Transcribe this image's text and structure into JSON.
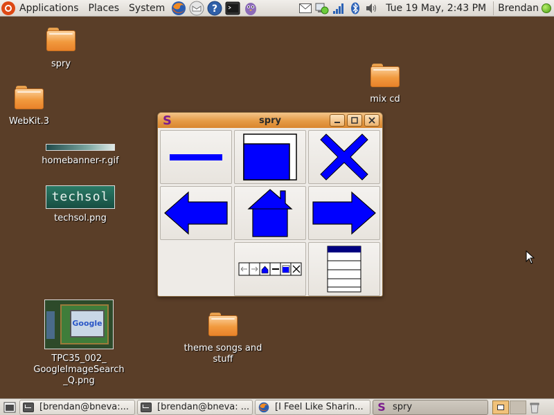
{
  "top_panel": {
    "menus": [
      "Applications",
      "Places",
      "System"
    ],
    "launchers": [
      "firefox-icon",
      "mail-icon",
      "help-icon",
      "terminal-icon",
      "pidgin-icon"
    ],
    "tray_icons": [
      "mail-envelope-icon",
      "network-manager-icon",
      "signal-bars-icon",
      "bluetooth-icon",
      "volume-icon"
    ],
    "clock": "Tue 19 May,  2:43 PM",
    "user": "Brendan"
  },
  "desktop": {
    "icons": {
      "spry": "spry",
      "webkit": "WebKit.3",
      "homebanner": "homebanner-r.gif",
      "techsol": "techsol.png",
      "techsol_thumb_text": "techsol",
      "tpc35": "TPC35_002_\nGoogleImageSearch\n_Q.png",
      "tpc35_thumb_text": "Google",
      "mix_cd": "mix cd",
      "theme_songs": "theme songs and\nstuff"
    }
  },
  "window": {
    "title": "spry",
    "app_letter": "S",
    "buttons": [
      "minimize",
      "maximize",
      "close"
    ],
    "tiles": [
      "minimize-bar",
      "maximize-box",
      "close-x",
      "back-arrow",
      "home",
      "forward-arrow",
      "",
      "toolbar-preview",
      "table-list"
    ],
    "accent_color": "#0000ff"
  },
  "bottom_panel": {
    "tasks": [
      {
        "label": "[brendan@bneva:...",
        "icon": "terminal-icon",
        "active": false
      },
      {
        "label": "[brendan@bneva: ...",
        "icon": "terminal-icon",
        "active": false
      },
      {
        "label": "[I Feel Like Sharin...",
        "icon": "firefox-icon",
        "active": false
      },
      {
        "label": "spry",
        "icon": "spry-icon",
        "active": true
      }
    ]
  }
}
